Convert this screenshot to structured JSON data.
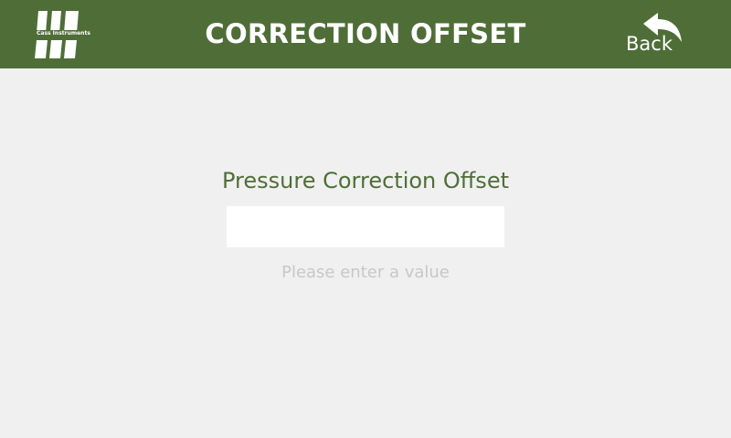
{
  "header": {
    "title": "CORRECTION OFFSET",
    "logo_text": "Cass Instruments",
    "back_label": "Back",
    "background_color": "#4f6e37"
  },
  "form": {
    "label": "Pressure Correction Offset",
    "value": "",
    "helper_text": "Please enter a value",
    "label_color": "#4f6e37"
  },
  "icons": {
    "logo": "cass-instruments-logo-icon",
    "back": "curved-back-arrow-icon"
  }
}
